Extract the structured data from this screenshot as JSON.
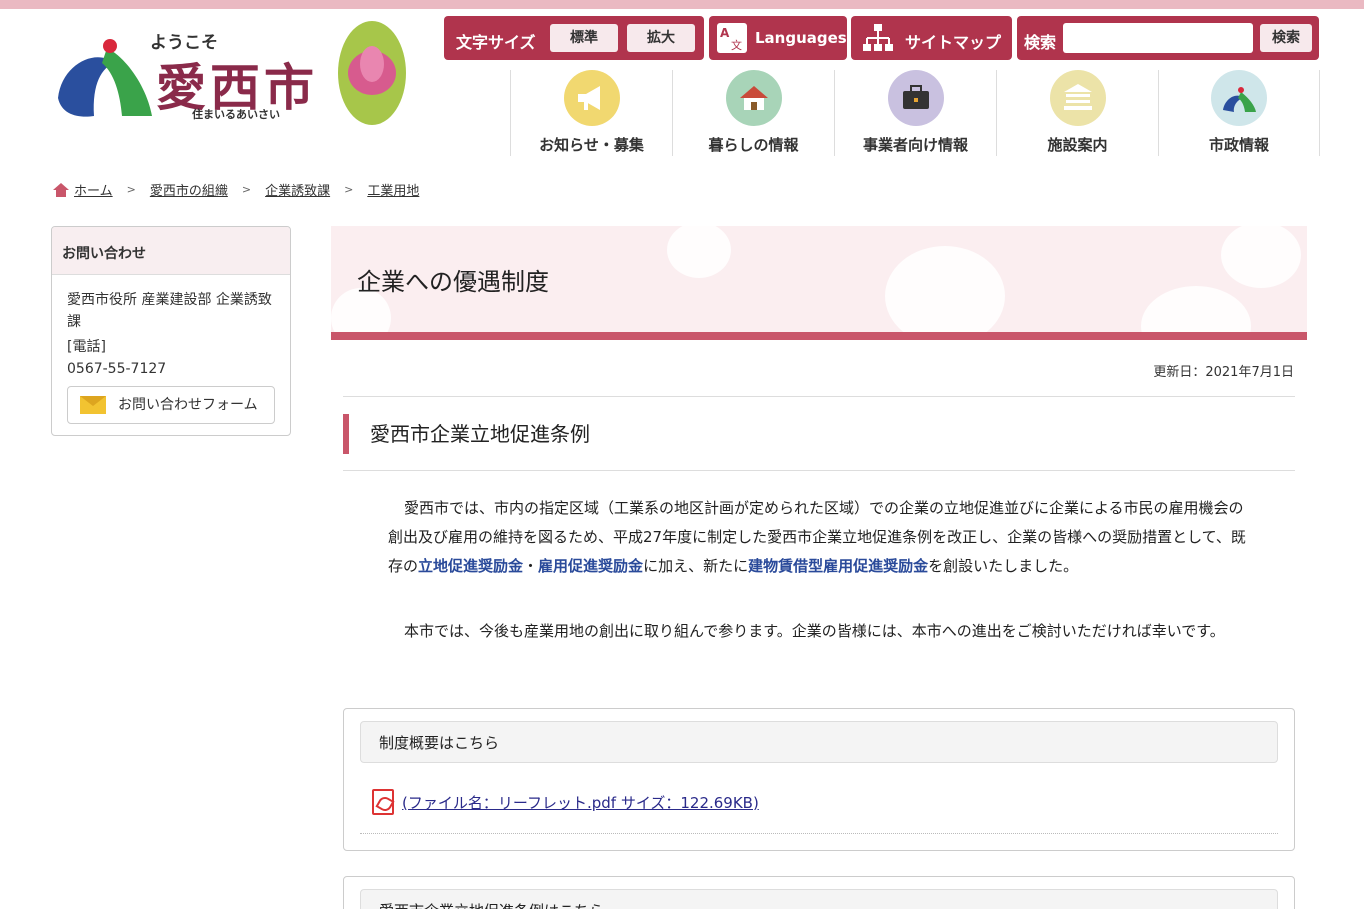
{
  "header": {
    "logo_small": "ようこそ",
    "logo_main": "愛西市",
    "logo_sub": "住まいるあいさい",
    "font_size_label": "文字サイズ",
    "font_standard": "標準",
    "font_large": "拡大",
    "languages": "Languages",
    "sitemap": "サイトマップ",
    "search_label": "検索",
    "search_button": "検索",
    "search_placeholder": ""
  },
  "nav": [
    {
      "label": "お知らせ・募集",
      "icon": "megaphone-icon",
      "color": "#f1d870"
    },
    {
      "label": "暮らしの情報",
      "icon": "house-icon",
      "color": "#a8d4b8"
    },
    {
      "label": "事業者向け情報",
      "icon": "briefcase-icon",
      "color": "#c9c1e0"
    },
    {
      "label": "施設案内",
      "icon": "building-icon",
      "color": "#ece3a8"
    },
    {
      "label": "市政情報",
      "icon": "city-logo-icon",
      "color": "#cfe6ea"
    }
  ],
  "breadcrumb": [
    "ホーム",
    "愛西市の組織",
    "企業誘致課",
    "工業用地"
  ],
  "contact": {
    "title": "お問い合わせ",
    "dept": "愛西市役所 産業建設部 企業誘致課",
    "phone_label": "[電話]",
    "phone": "0567-55-7127",
    "form_button": "お問い合わせフォーム"
  },
  "main": {
    "title": "企業への優遇制度",
    "updated": "更新日：2021年7月1日",
    "section_title": "愛西市企業立地促進条例",
    "para1_a": "愛西市では、市内の指定区域（工業系の地区計画が定められた区域）での企業の立地促進並びに企業による市民の雇用機会の創出及び雇用の維持を図るため、平成27年度に制定した愛西市企業立地促進条例を改正し、企業の皆様への奨励措置として、既存の",
    "para1_b": "立地促進奨励金",
    "para1_c": "・",
    "para1_d": "雇用促進奨励金",
    "para1_e": "に加え、新たに",
    "para1_f": "建物賃借型雇用促進奨励金",
    "para1_g": "を創設いたしました。",
    "para2": "本市では、今後も産業用地の創出に取り組んで参ります。企業の皆様には、本市への進出をご検討いただければ幸いです。",
    "file_box_title": "制度概要はこちら",
    "file_link": "(ファイル名：リーフレット.pdf サイズ：122.69KB)",
    "file_box2_title": "愛西市企業立地促進条例はこちら"
  },
  "colors": {
    "brand": "#b0344d",
    "accent": "#c9566a",
    "band": "#fbeef0"
  }
}
